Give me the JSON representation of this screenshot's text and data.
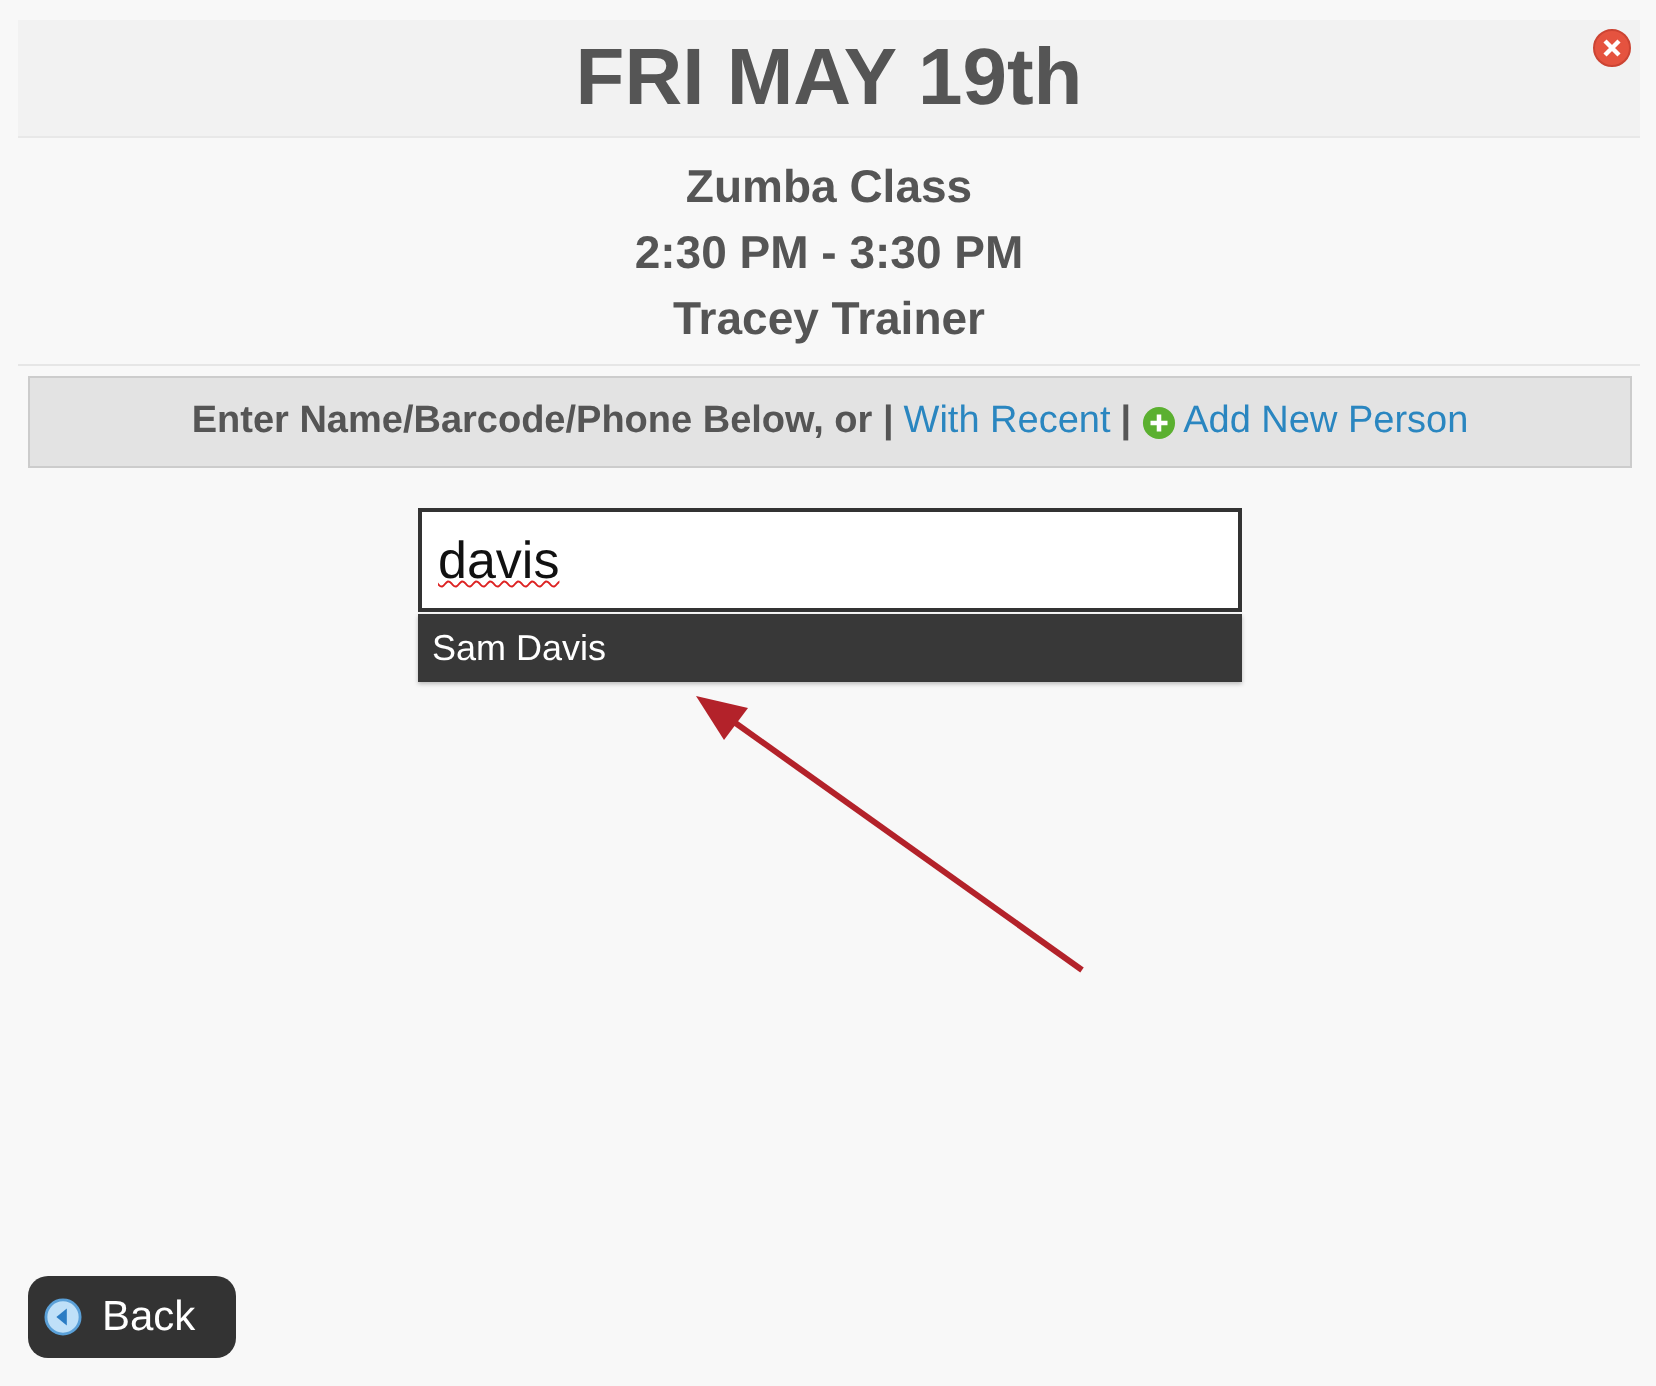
{
  "header": {
    "title": "FRI MAY 19th"
  },
  "class_info": [
    "Zumba Class",
    "2:30 PM - 3:30 PM",
    "Tracey Trainer"
  ],
  "prompt_bar": {
    "text": "Enter Name/Barcode/Phone Below, or |",
    "recent_link": "With Recent",
    "separator": "|",
    "add_link": "Add New Person"
  },
  "search": {
    "value": "davis"
  },
  "suggestions": [
    {
      "label": "Sam Davis",
      "selected": true
    }
  ],
  "back_button": {
    "label": "Back"
  }
}
